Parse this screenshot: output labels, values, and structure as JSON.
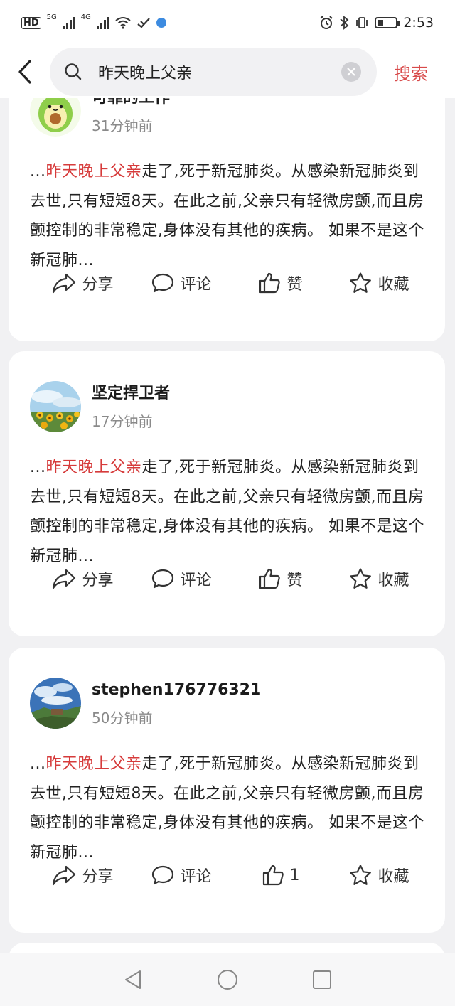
{
  "status_bar": {
    "hd_label": "HD",
    "net_1": "5G",
    "net_2": "4G",
    "time": "2:53"
  },
  "search": {
    "query": "昨天晚上父亲",
    "submit_label": "搜索"
  },
  "posts": [
    {
      "username": "可靠的工作",
      "time": "31分钟前",
      "prefix": "...",
      "highlight": "昨天晚上父亲",
      "rest": "走了,死于新冠肺炎。从感染新冠肺炎到去世,只有短短8天。在此之前,父亲只有轻微房颤,而且房颤控制的非常稳定,身体没有其他的疾病。 如果不是这个新冠肺...",
      "share": "分享",
      "comment": "评论",
      "like": "赞",
      "collect": "收藏"
    },
    {
      "username": "坚定捍卫者",
      "time": "17分钟前",
      "prefix": "...",
      "highlight": "昨天晚上父亲",
      "rest": "走了,死于新冠肺炎。从感染新冠肺炎到去世,只有短短8天。在此之前,父亲只有轻微房颤,而且房颤控制的非常稳定,身体没有其他的疾病。 如果不是这个新冠肺...",
      "share": "分享",
      "comment": "评论",
      "like": "赞",
      "collect": "收藏"
    },
    {
      "username": "stephen176776321",
      "time": "50分钟前",
      "prefix": "...",
      "highlight": "昨天晚上父亲",
      "rest": "走了,死于新冠肺炎。从感染新冠肺炎到去世,只有短短8天。在此之前,父亲只有轻微房颤,而且房颤控制的非常稳定,身体没有其他的疾病。 如果不是这个新冠肺...",
      "share": "分享",
      "comment": "评论",
      "like": "1",
      "collect": "收藏"
    }
  ],
  "colors": {
    "highlight": "#d63b3b",
    "search_button": "#d84a4a",
    "background": "#f1f1f3"
  }
}
